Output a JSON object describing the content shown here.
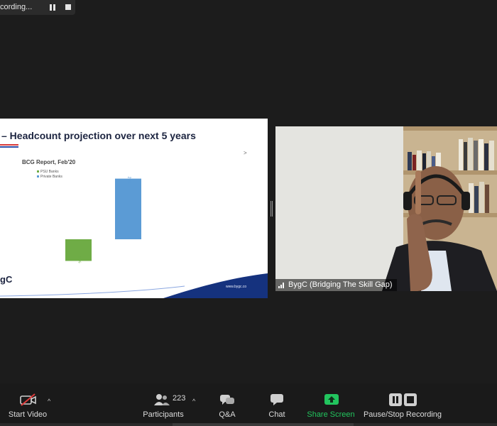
{
  "recording": {
    "label": "cording..."
  },
  "slide": {
    "title": "– Headcount projection over next 5 years",
    "logo": "gC",
    "footer_url": "www.bygc.co",
    "arrow": ">"
  },
  "chart_data": {
    "type": "bar",
    "title": "BCG Report, Feb'20",
    "categories": [
      "PSU Banks",
      "Private Banks"
    ],
    "series": [
      {
        "name": "PSU Banks",
        "values": [
          -10
        ],
        "color": "#6fac46"
      },
      {
        "name": "Private Banks",
        "values": [
          28
        ],
        "color": "#5b9bd5"
      }
    ],
    "data_labels": [
      "-10%",
      "28%"
    ],
    "legend_position": "top-left",
    "grid": false
  },
  "video": {
    "participant_name": "BygC (Bridging The Skill Gap)"
  },
  "toolbar": {
    "start_video": "Start Video",
    "participants": "Participants",
    "participants_count": "223",
    "qa": "Q&A",
    "chat": "Chat",
    "share_screen": "Share Screen",
    "pause_stop_recording": "Pause/Stop Recording",
    "caret": "^"
  },
  "colors": {
    "share_green": "#22c55e",
    "toolbar_bg": "#1a1a1a",
    "slide_navy": "#15327e"
  }
}
